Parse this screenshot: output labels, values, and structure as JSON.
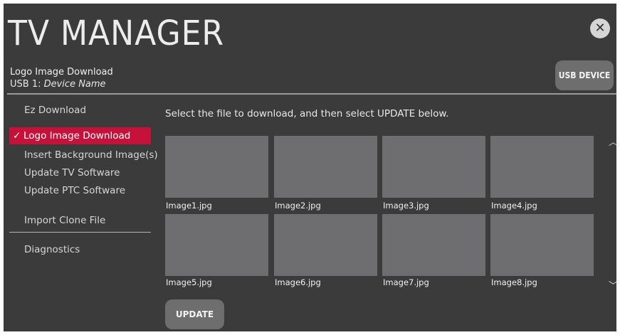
{
  "app": {
    "title": "TV MANAGER",
    "close_glyph": "✕",
    "breadcrumb": "Logo Image Download",
    "device_prefix": "USB 1: ",
    "device_name": "Device Name",
    "usb_button_label": "USB DEVICE"
  },
  "menu": {
    "items": [
      {
        "label": "Ez Download"
      },
      {
        "label": "Logo Image Download",
        "selected": true
      },
      {
        "label": "Insert Background Image(s)"
      },
      {
        "label": "Update TV Software"
      },
      {
        "label": "Update PTC Software"
      },
      {
        "label": "Import Clone File"
      },
      {
        "label": "Diagnostics"
      }
    ],
    "check_glyph": "✓"
  },
  "main": {
    "instruction": "Select the file to download, and then select UPDATE below.",
    "files": [
      "Image1.jpg",
      "Image2.jpg",
      "Image3.jpg",
      "Image4.jpg",
      "Image5.jpg",
      "Image6.jpg",
      "Image7.jpg",
      "Image8.jpg"
    ],
    "scroll_up_glyph": "︿",
    "scroll_down_glyph": "﹀",
    "update_label": "UPDATE"
  },
  "colors": {
    "background": "#3b3b3b",
    "accent": "#c6123b",
    "thumbnail": "#6e6e70",
    "button": "#6e6e6e"
  }
}
